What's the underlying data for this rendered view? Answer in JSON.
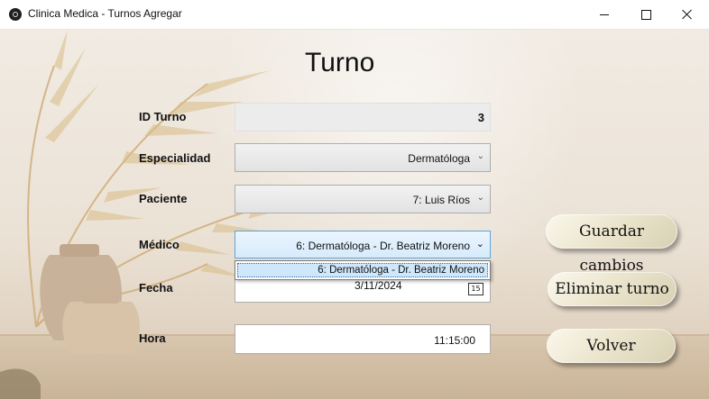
{
  "window": {
    "title": "Clinica Medica - Turnos Agregar",
    "controls": [
      "minimize-icon",
      "maximize-icon",
      "close-icon"
    ]
  },
  "form": {
    "title": "Turno",
    "id_label": "ID Turno",
    "id_value": "3",
    "especialidad_label": "Especialidad",
    "especialidad_value": "Dermatóloga",
    "paciente_label": "Paciente",
    "paciente_value": "7: Luis Ríos",
    "medico_label": "Médico",
    "medico_value": "6: Dermatóloga - Dr. Beatriz Moreno",
    "medico_options": [
      "6: Dermatóloga - Dr. Beatriz Moreno"
    ],
    "fecha_label": "Fecha",
    "fecha_value": "3/11/2024",
    "calendar_icon_text": "15",
    "hora_label": "Hora",
    "hora_value": "11:15:00"
  },
  "buttons": {
    "save": "Guardar cambios",
    "delete": "Eliminar turno",
    "back": "Volver"
  },
  "colors": {
    "dropdown_highlight": "#cfe7fb",
    "focus_border": "#5ca4d8"
  }
}
